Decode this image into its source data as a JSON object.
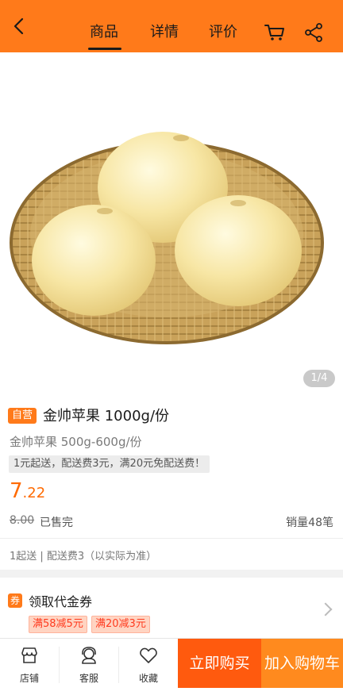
{
  "header": {
    "tabs": [
      {
        "label": "商品",
        "active": true
      },
      {
        "label": "详情",
        "active": false
      },
      {
        "label": "评价",
        "active": false
      }
    ],
    "icons": [
      "back-icon",
      "cart-icon",
      "share-icon"
    ],
    "accent_color": "#ff7a1a"
  },
  "gallery": {
    "pager": "1/4"
  },
  "product": {
    "badge": "自营",
    "title": "金帅苹果 1000g/份",
    "subtitle": "金帅苹果 500g-600g/份",
    "notice": "1元起送，配送费3元，满20元免配送费！",
    "price_int": "7",
    "price_dec": ".22",
    "original_price": "8.00",
    "stock_status": "已售完",
    "sales": "销量48笔",
    "delivery": "1起送 | 配送费3（以实际为准）"
  },
  "coupon": {
    "icon_label": "券",
    "title": "领取代金券",
    "tags": [
      "满58减5元",
      "满20减3元"
    ]
  },
  "bottom_bar": {
    "shop": "店铺",
    "service": "客服",
    "favorite": "收藏",
    "buy_now": "立即购买",
    "add_to_cart": "加入购物车"
  }
}
